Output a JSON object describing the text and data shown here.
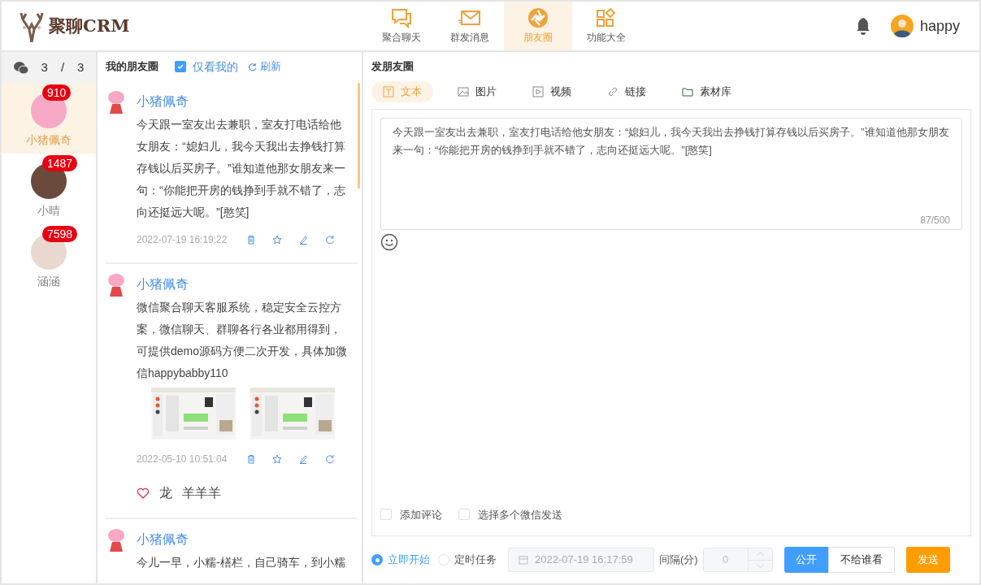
{
  "header": {
    "logo": "聚聊CRM",
    "nav": [
      {
        "label": "聚合聊天",
        "selected": false
      },
      {
        "label": "群发消息",
        "selected": false
      },
      {
        "label": "朋友圈",
        "selected": true
      },
      {
        "label": "功能大全",
        "selected": false
      }
    ],
    "user": "happy"
  },
  "sidebar": {
    "count_current": "3",
    "count_separator": "/",
    "count_total": "3",
    "accounts": [
      {
        "name": "小猪佩奇",
        "badge": "910",
        "selected": true
      },
      {
        "name": "小晴",
        "badge": "1487",
        "selected": false
      },
      {
        "name": "涵涵",
        "badge": "7598",
        "selected": false
      }
    ]
  },
  "feed": {
    "title": "我的朋友圈",
    "only_mine": {
      "label": "仅看我的",
      "checked": true
    },
    "refresh": "刷新",
    "posts": [
      {
        "author": "小猪佩奇",
        "text": "今天跟一室友出去兼职，室友打电话给他女朋友：“媳妇儿，我今天我出去挣钱打算存钱以后买房子。”谁知道他那女朋友来一句：“你能把开房的钱挣到手就不错了，志向还挺远大呢。”[憨笑]",
        "time": "2022-07-19 16:19:22"
      },
      {
        "author": "小猪佩奇",
        "text": "微信聚合聊天客服系统，稳定安全云控方案，微信聊天、群聊各行各业都用得到，可提供demo源码方便二次开发，具体加微信happybabby110",
        "images": [
          {
            "kind": "picture"
          },
          {
            "kind": "picture"
          }
        ],
        "time": "2022-05-10 10:51:04",
        "likes": [
          "龙",
          "羊羊羊"
        ]
      },
      {
        "author": "小猪佩奇",
        "text": "今儿一早，小糯-橏栏，自己骑车，到小糯"
      }
    ]
  },
  "composer": {
    "title": "发朋友圈",
    "tabs": [
      {
        "label": "文本",
        "selected": true
      },
      {
        "label": "图片",
        "selected": false
      },
      {
        "label": "视频",
        "selected": false
      },
      {
        "label": "链接",
        "selected": false
      },
      {
        "label": "素材库",
        "selected": false
      }
    ],
    "text": "今天跟一室友出去兼职，室友打电话给他女朋友：“媳妇儿，我今天我出去挣钱打算存钱以后买房子。”谁知道他那女朋友来一句：“你能把开房的钱挣到手就不错了，志向还挺远大呢。”[憨笑]",
    "counter": "87/500",
    "options": [
      {
        "label": "添加评论",
        "checked": false
      },
      {
        "label": "选择多个微信发送",
        "checked": false
      }
    ],
    "schedule": [
      {
        "label": "立即开始",
        "selected": true
      },
      {
        "label": "定时任务",
        "selected": false
      }
    ],
    "datetime": "2022-07-19 16:17:59",
    "interval_label": "间隔(分)",
    "interval": "0",
    "visibility": [
      {
        "label": "公开",
        "selected": true
      },
      {
        "label": "不给谁看",
        "selected": false
      }
    ],
    "send": "发送"
  }
}
